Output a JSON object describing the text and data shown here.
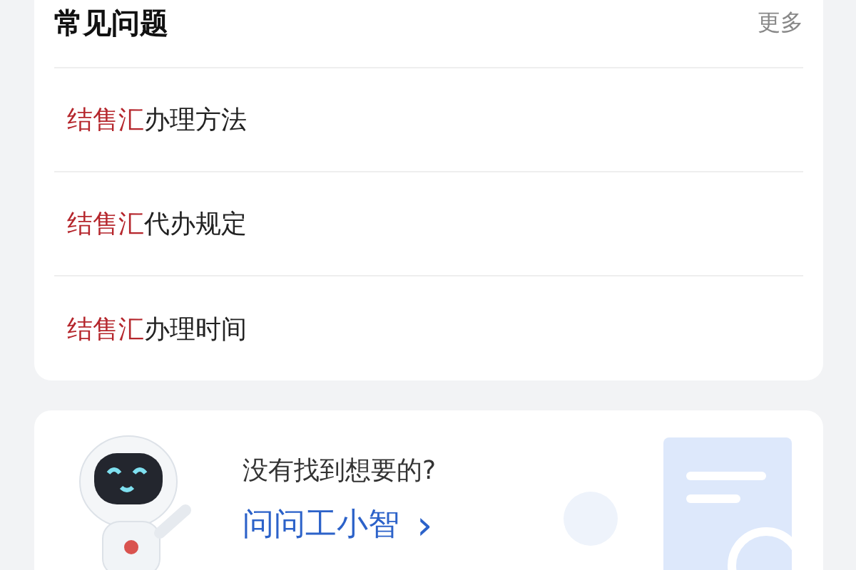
{
  "faq": {
    "title": "常见问题",
    "more": "更多",
    "items": [
      {
        "keyword": "结售汇",
        "text": "办理方法"
      },
      {
        "keyword": "结售汇",
        "text": "代办规定"
      },
      {
        "keyword": "结售汇",
        "text": "办理时间"
      }
    ]
  },
  "assistant": {
    "prompt": "没有找到想要的?",
    "link": "问问工小智",
    "chevron": "›"
  }
}
